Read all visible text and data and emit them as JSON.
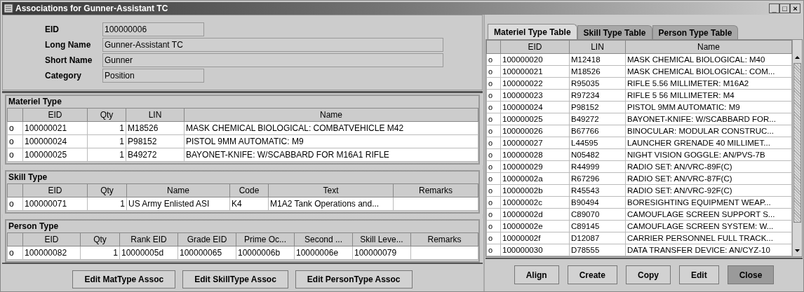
{
  "window": {
    "title": "Associations for Gunner-Assistant TC",
    "controls": [
      "_",
      "□",
      "×"
    ]
  },
  "form": [
    {
      "label": "EID",
      "value": "100000006"
    },
    {
      "label": "Long Name",
      "value": "Gunner-Assistant TC"
    },
    {
      "label": "Short Name",
      "value": "Gunner"
    },
    {
      "label": "Category",
      "value": "Position"
    }
  ],
  "sections": [
    {
      "title": "Materiel Type",
      "columns": [
        "EID",
        "Qty",
        "LIN",
        "Name"
      ],
      "rows": [
        {
          "marker": "o",
          "cells": [
            "100000021",
            "1",
            "M18526",
            "MASK CHEMICAL BIOLOGICAL: COMBATVEHICLE M42"
          ]
        },
        {
          "marker": "o",
          "cells": [
            "100000024",
            "1",
            "P98152",
            "PISTOL 9MM AUTOMATIC: M9"
          ]
        },
        {
          "marker": "o",
          "cells": [
            "100000025",
            "1",
            "B49272",
            "BAYONET-KNIFE: W/SCABBARD FOR M16A1 RIFLE"
          ]
        }
      ]
    },
    {
      "title": "Skill Type",
      "columns": [
        "EID",
        "Qty",
        "Name",
        "Code",
        "Text",
        "Remarks"
      ],
      "rows": [
        {
          "marker": "o",
          "cells": [
            "100000071",
            "1",
            "US Army Enlisted ASI",
            "K4",
            "M1A2 Tank Operations and...",
            ""
          ]
        }
      ]
    },
    {
      "title": "Person Type",
      "columns": [
        "EID",
        "Qty",
        "Rank EID",
        "Grade EID",
        "Prime Oc...",
        "Second ...",
        "Skill Leve...",
        "Remarks"
      ],
      "rows": [
        {
          "marker": "o",
          "cells": [
            "100000082",
            "1",
            "10000005d",
            "100000065",
            "10000006b",
            "10000006e",
            "100000079",
            ""
          ]
        }
      ]
    }
  ],
  "left_buttons": [
    "Edit MatType Assoc",
    "Edit SkillType Assoc",
    "Edit PersonType Assoc"
  ],
  "tabs": [
    {
      "label": "Materiel Type Table",
      "selected": true
    },
    {
      "label": "Skill Type Table",
      "selected": false
    },
    {
      "label": "Person Type Table",
      "selected": false
    }
  ],
  "table": {
    "columns": [
      "EID",
      "LIN",
      "Name"
    ],
    "rows": [
      {
        "marker": "o",
        "cells": [
          "100000020",
          "M12418",
          "MASK CHEMICAL BIOLOGICAL: M40"
        ]
      },
      {
        "marker": "o",
        "cells": [
          "100000021",
          "M18526",
          "MASK CHEMICAL BIOLOGICAL: COM..."
        ]
      },
      {
        "marker": "o",
        "cells": [
          "100000022",
          "R95035",
          "RIFLE 5.56 MILLIMETER: M16A2"
        ]
      },
      {
        "marker": "o",
        "cells": [
          "100000023",
          "R97234",
          "RIFLE 5 56 MILLIMETER: M4"
        ]
      },
      {
        "marker": "o",
        "cells": [
          "100000024",
          "P98152",
          "PISTOL 9MM AUTOMATIC: M9"
        ]
      },
      {
        "marker": "o",
        "cells": [
          "100000025",
          "B49272",
          "BAYONET-KNIFE: W/SCABBARD FOR..."
        ]
      },
      {
        "marker": "o",
        "cells": [
          "100000026",
          "B67766",
          "BINOCULAR: MODULAR CONSTRUC..."
        ]
      },
      {
        "marker": "o",
        "cells": [
          "100000027",
          "L44595",
          "LAUNCHER GRENADE 40 MILLIMET..."
        ]
      },
      {
        "marker": "o",
        "cells": [
          "100000028",
          "N05482",
          "NIGHT VISION GOGGLE: AN/PVS-7B"
        ]
      },
      {
        "marker": "o",
        "cells": [
          "100000029",
          "R44999",
          "RADIO SET: AN/VRC-89F(C)"
        ]
      },
      {
        "marker": "o",
        "cells": [
          "10000002a",
          "R67296",
          "RADIO SET: AN/VRC-87F(C)"
        ]
      },
      {
        "marker": "o",
        "cells": [
          "10000002b",
          "R45543",
          "RADIO SET: AN/VRC-92F(C)"
        ]
      },
      {
        "marker": "o",
        "cells": [
          "10000002c",
          "B90494",
          "BORESIGHTING EQUIPMENT WEAP..."
        ]
      },
      {
        "marker": "o",
        "cells": [
          "10000002d",
          "C89070",
          "CAMOUFLAGE SCREEN SUPPORT S..."
        ]
      },
      {
        "marker": "o",
        "cells": [
          "10000002e",
          "C89145",
          "CAMOUFLAGE SCREEN SYSTEM: W..."
        ]
      },
      {
        "marker": "o",
        "cells": [
          "10000002f",
          "D12087",
          "CARRIER PERSONNEL FULL TRACK..."
        ]
      },
      {
        "marker": "o",
        "cells": [
          "100000030",
          "D78555",
          "DATA TRANSFER DEVICE: AN/CYZ-10"
        ]
      }
    ]
  },
  "right_buttons": [
    {
      "label": "Align",
      "pressed": false
    },
    {
      "label": "Create",
      "pressed": false
    },
    {
      "label": "Copy",
      "pressed": false
    },
    {
      "label": "Edit",
      "pressed": false
    },
    {
      "label": "Close",
      "pressed": true
    }
  ]
}
